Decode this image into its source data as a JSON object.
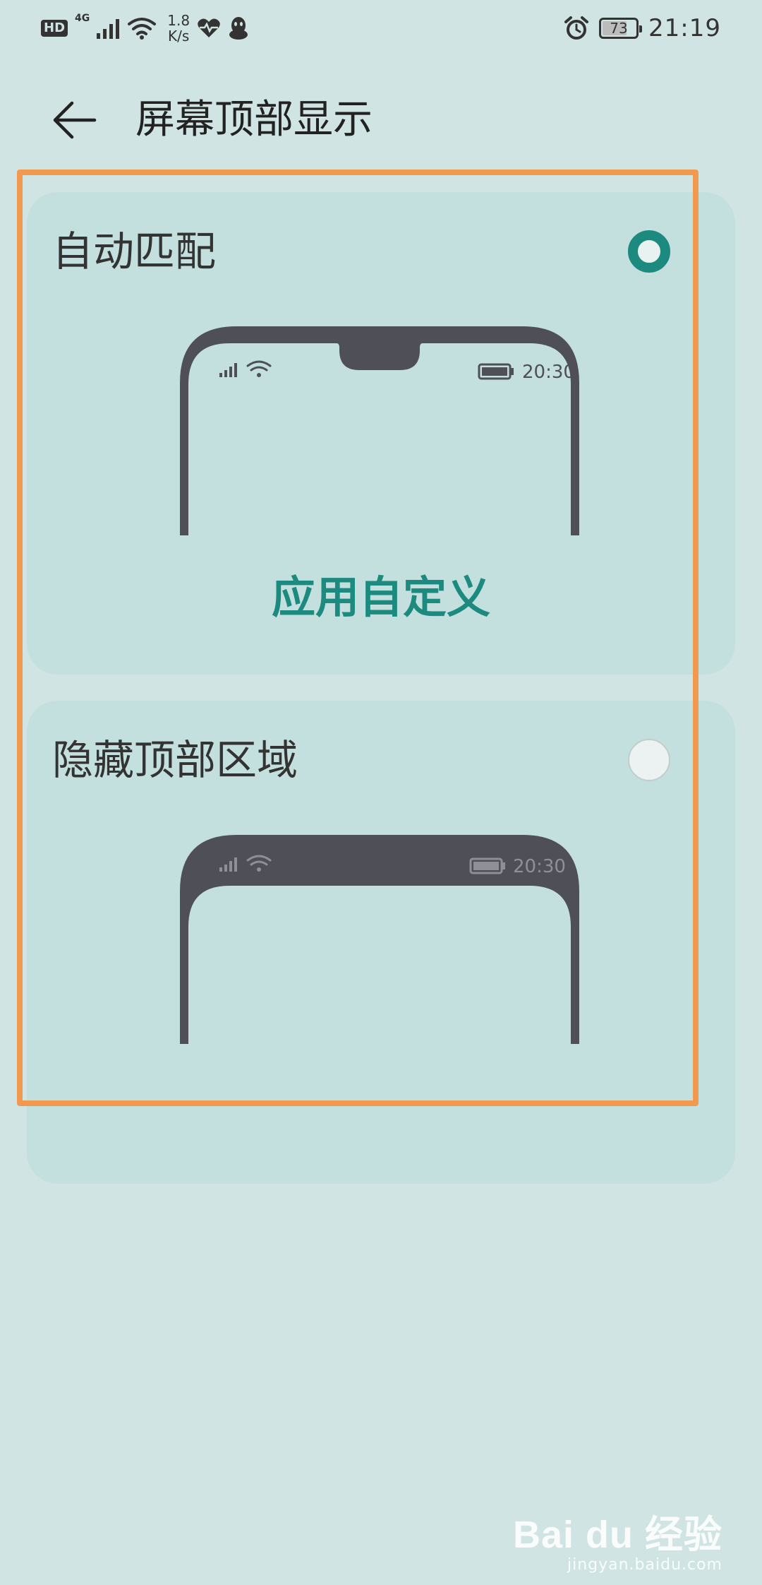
{
  "status_bar": {
    "hd": "HD",
    "network_type": "4G",
    "speed_value": "1.8",
    "speed_unit": "K/s",
    "battery": "73",
    "battery_level_percent": 73,
    "time": "21:19"
  },
  "header": {
    "title": "屏幕顶部显示"
  },
  "options": [
    {
      "title": "自动匹配",
      "selected": true,
      "preview_time": "20:30",
      "action_label": "应用自定义"
    },
    {
      "title": "隐藏顶部区域",
      "selected": false,
      "preview_time": "20:30"
    }
  ],
  "colors": {
    "background": "#cfe4e3",
    "card": "#c3dfde",
    "accent": "#1c8a7f",
    "phone_frame": "#4f4f58",
    "highlight": "#f1994e"
  },
  "watermark": {
    "logo": "Bai du 经验",
    "url": "jingyan.baidu.com"
  }
}
